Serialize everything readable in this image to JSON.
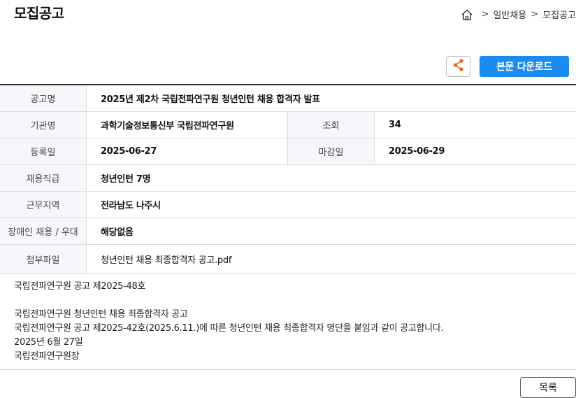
{
  "header": {
    "title": "모집공고",
    "breadcrumb": [
      "일반채용",
      "모집공고"
    ],
    "breadcrumb_sep": ">"
  },
  "actions": {
    "download_label": "본문 다운로드"
  },
  "table": {
    "title_label": "공고명",
    "title_value": "2025년 제2차 국립전파연구원 청년인턴 채용 합격자 발표",
    "org_label": "기관명",
    "org_value": "과학기술정보통신부 국립전파연구원",
    "views_label": "조회",
    "views_value": "34",
    "reg_label": "등록일",
    "reg_value": "2025-06-27",
    "deadline_label": "마감일",
    "deadline_value": "2025-06-29",
    "position_label": "채용직급",
    "position_value": "청년인턴 7명",
    "region_label": "근무지역",
    "region_value": "전라남도 나주시",
    "disability_label": "장애인 채용 / 우대",
    "disability_value": "해당없음",
    "attach_label": "첨부파일",
    "attach_value": "청년인턴 채용 최종합격자 공고.pdf"
  },
  "content": {
    "line1": "국립전파연구원 공고 제2025-48호",
    "line2": "국립전파연구원 청년인턴 채용 최종합격자 공고",
    "line3": "국립전파연구원 공고 제2025-42호(2025.6.11.)에 따른 청년인턴 채용 최종합격자 명단을 붙임과 같이 공고합니다.",
    "line4": "2025년 6월 27일",
    "line5": "국립전파연구원장"
  },
  "footer": {
    "list_label": "목록"
  },
  "colors": {
    "accent": "#1a8cf0",
    "share_icon": "#e8611a"
  }
}
